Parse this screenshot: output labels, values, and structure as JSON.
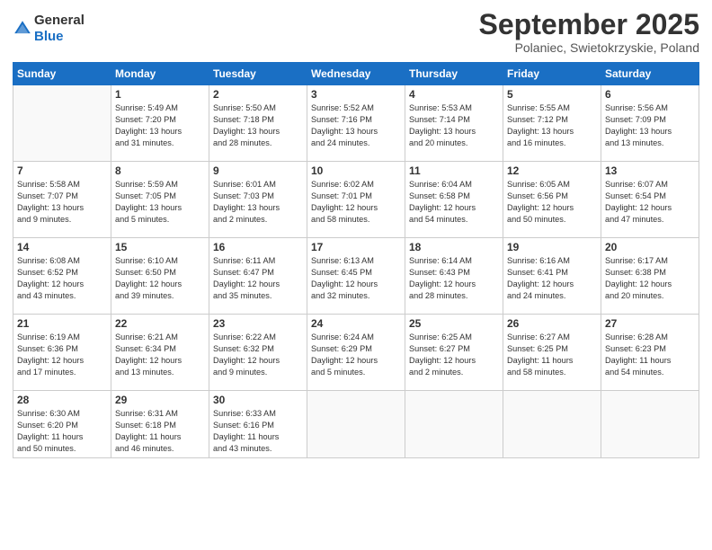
{
  "header": {
    "logo_line1": "General",
    "logo_line2": "Blue",
    "month": "September 2025",
    "location": "Polaniec, Swietokrzyskie, Poland"
  },
  "weekdays": [
    "Sunday",
    "Monday",
    "Tuesday",
    "Wednesday",
    "Thursday",
    "Friday",
    "Saturday"
  ],
  "weeks": [
    [
      {
        "day": "",
        "info": ""
      },
      {
        "day": "1",
        "info": "Sunrise: 5:49 AM\nSunset: 7:20 PM\nDaylight: 13 hours\nand 31 minutes."
      },
      {
        "day": "2",
        "info": "Sunrise: 5:50 AM\nSunset: 7:18 PM\nDaylight: 13 hours\nand 28 minutes."
      },
      {
        "day": "3",
        "info": "Sunrise: 5:52 AM\nSunset: 7:16 PM\nDaylight: 13 hours\nand 24 minutes."
      },
      {
        "day": "4",
        "info": "Sunrise: 5:53 AM\nSunset: 7:14 PM\nDaylight: 13 hours\nand 20 minutes."
      },
      {
        "day": "5",
        "info": "Sunrise: 5:55 AM\nSunset: 7:12 PM\nDaylight: 13 hours\nand 16 minutes."
      },
      {
        "day": "6",
        "info": "Sunrise: 5:56 AM\nSunset: 7:09 PM\nDaylight: 13 hours\nand 13 minutes."
      }
    ],
    [
      {
        "day": "7",
        "info": "Sunrise: 5:58 AM\nSunset: 7:07 PM\nDaylight: 13 hours\nand 9 minutes."
      },
      {
        "day": "8",
        "info": "Sunrise: 5:59 AM\nSunset: 7:05 PM\nDaylight: 13 hours\nand 5 minutes."
      },
      {
        "day": "9",
        "info": "Sunrise: 6:01 AM\nSunset: 7:03 PM\nDaylight: 13 hours\nand 2 minutes."
      },
      {
        "day": "10",
        "info": "Sunrise: 6:02 AM\nSunset: 7:01 PM\nDaylight: 12 hours\nand 58 minutes."
      },
      {
        "day": "11",
        "info": "Sunrise: 6:04 AM\nSunset: 6:58 PM\nDaylight: 12 hours\nand 54 minutes."
      },
      {
        "day": "12",
        "info": "Sunrise: 6:05 AM\nSunset: 6:56 PM\nDaylight: 12 hours\nand 50 minutes."
      },
      {
        "day": "13",
        "info": "Sunrise: 6:07 AM\nSunset: 6:54 PM\nDaylight: 12 hours\nand 47 minutes."
      }
    ],
    [
      {
        "day": "14",
        "info": "Sunrise: 6:08 AM\nSunset: 6:52 PM\nDaylight: 12 hours\nand 43 minutes."
      },
      {
        "day": "15",
        "info": "Sunrise: 6:10 AM\nSunset: 6:50 PM\nDaylight: 12 hours\nand 39 minutes."
      },
      {
        "day": "16",
        "info": "Sunrise: 6:11 AM\nSunset: 6:47 PM\nDaylight: 12 hours\nand 35 minutes."
      },
      {
        "day": "17",
        "info": "Sunrise: 6:13 AM\nSunset: 6:45 PM\nDaylight: 12 hours\nand 32 minutes."
      },
      {
        "day": "18",
        "info": "Sunrise: 6:14 AM\nSunset: 6:43 PM\nDaylight: 12 hours\nand 28 minutes."
      },
      {
        "day": "19",
        "info": "Sunrise: 6:16 AM\nSunset: 6:41 PM\nDaylight: 12 hours\nand 24 minutes."
      },
      {
        "day": "20",
        "info": "Sunrise: 6:17 AM\nSunset: 6:38 PM\nDaylight: 12 hours\nand 20 minutes."
      }
    ],
    [
      {
        "day": "21",
        "info": "Sunrise: 6:19 AM\nSunset: 6:36 PM\nDaylight: 12 hours\nand 17 minutes."
      },
      {
        "day": "22",
        "info": "Sunrise: 6:21 AM\nSunset: 6:34 PM\nDaylight: 12 hours\nand 13 minutes."
      },
      {
        "day": "23",
        "info": "Sunrise: 6:22 AM\nSunset: 6:32 PM\nDaylight: 12 hours\nand 9 minutes."
      },
      {
        "day": "24",
        "info": "Sunrise: 6:24 AM\nSunset: 6:29 PM\nDaylight: 12 hours\nand 5 minutes."
      },
      {
        "day": "25",
        "info": "Sunrise: 6:25 AM\nSunset: 6:27 PM\nDaylight: 12 hours\nand 2 minutes."
      },
      {
        "day": "26",
        "info": "Sunrise: 6:27 AM\nSunset: 6:25 PM\nDaylight: 11 hours\nand 58 minutes."
      },
      {
        "day": "27",
        "info": "Sunrise: 6:28 AM\nSunset: 6:23 PM\nDaylight: 11 hours\nand 54 minutes."
      }
    ],
    [
      {
        "day": "28",
        "info": "Sunrise: 6:30 AM\nSunset: 6:20 PM\nDaylight: 11 hours\nand 50 minutes."
      },
      {
        "day": "29",
        "info": "Sunrise: 6:31 AM\nSunset: 6:18 PM\nDaylight: 11 hours\nand 46 minutes."
      },
      {
        "day": "30",
        "info": "Sunrise: 6:33 AM\nSunset: 6:16 PM\nDaylight: 11 hours\nand 43 minutes."
      },
      {
        "day": "",
        "info": ""
      },
      {
        "day": "",
        "info": ""
      },
      {
        "day": "",
        "info": ""
      },
      {
        "day": "",
        "info": ""
      }
    ]
  ]
}
